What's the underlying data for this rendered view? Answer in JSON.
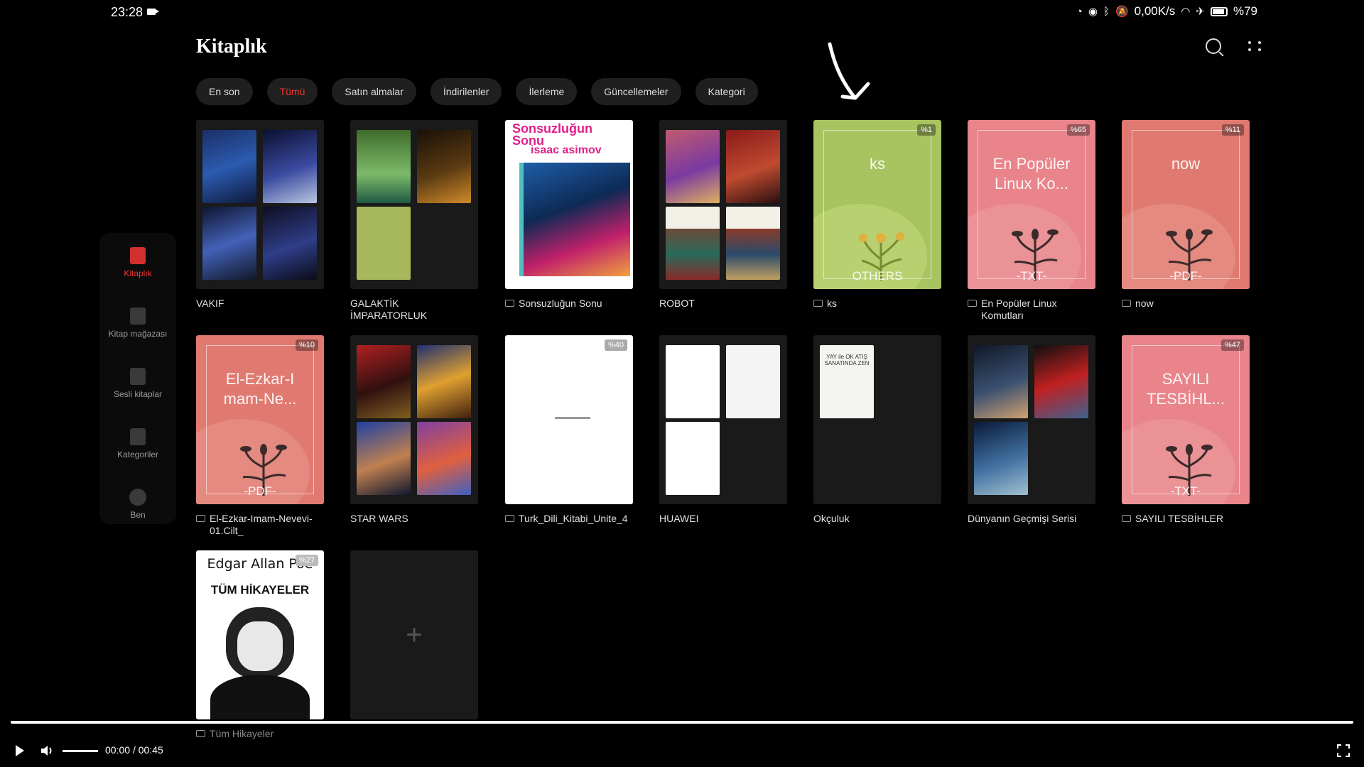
{
  "status": {
    "time": "23:28",
    "net_speed": "0,00K/s",
    "battery": "%79",
    "icons": [
      "speed-icon",
      "eye-icon",
      "bluetooth-icon",
      "mute-icon",
      "wifi-icon",
      "airplane-icon",
      "battery-icon"
    ]
  },
  "header": {
    "title": "Kitaplık"
  },
  "tabs": [
    "En son",
    "Tümü",
    "Satın almalar",
    "İndirilenler",
    "İlerleme",
    "Güncellemeler",
    "Kategori"
  ],
  "active_tab": "Tümü",
  "sidebar": [
    {
      "label": "Kitaplık",
      "icon": "library-icon",
      "active": true
    },
    {
      "label": "Kitap mağazası",
      "icon": "bookstore-icon"
    },
    {
      "label": "Sesli kitaplar",
      "icon": "audiobook-icon"
    },
    {
      "label": "Kategoriler",
      "icon": "categories-icon"
    },
    {
      "label": "Ben",
      "icon": "profile-icon"
    }
  ],
  "books": [
    {
      "label": "VAKIF"
    },
    {
      "label": "GALAKTİK İMPARATORLUK"
    },
    {
      "label": "Sonsuzluğun Sonu",
      "cover_title": "Sonsuzluğun Sonu",
      "cover_author": "isaac asimov"
    },
    {
      "label": "ROBOT"
    },
    {
      "label": "ks",
      "cover_title": "ks",
      "cover_footer": "OTHERS",
      "badge": "%1"
    },
    {
      "label": "En Popüler Linux Komutları",
      "cover_title": "En Popüler Linux Ko...",
      "cover_footer": "-TXT-",
      "badge": "%65"
    },
    {
      "label": "now",
      "cover_title": "now",
      "cover_footer": "-PDF-",
      "badge": "%11"
    },
    {
      "label": "El-Ezkar-Imam-Nevevi-01.Cilt_",
      "cover_title": "El-Ezkar-I mam-Ne...",
      "cover_footer": "-PDF-",
      "badge": "%10"
    },
    {
      "label": "STAR WARS"
    },
    {
      "label": "Turk_Dili_Kitabi_Unite_4",
      "badge": "%40"
    },
    {
      "label": "HUAWEI"
    },
    {
      "label": "Okçuluk",
      "cover_title": "YAY ile OK ATIŞ SANATINDA ZEN"
    },
    {
      "label": "Dünyanın Geçmişi Serisi"
    },
    {
      "label": "SAYILI TESBİHLER",
      "cover_title": "SAYILI TESBİHL...",
      "cover_footer": "-TXT-",
      "badge": "%47"
    },
    {
      "label": "Tüm Hikayeler",
      "cover_title": "Edgar Allan Poe",
      "cover_subtitle": "TÜM HİKAYELER",
      "badge": "%27"
    }
  ],
  "add_tile": "+",
  "video": {
    "current": "00:00",
    "separator": "/",
    "duration": "00:45",
    "progress": 0
  }
}
